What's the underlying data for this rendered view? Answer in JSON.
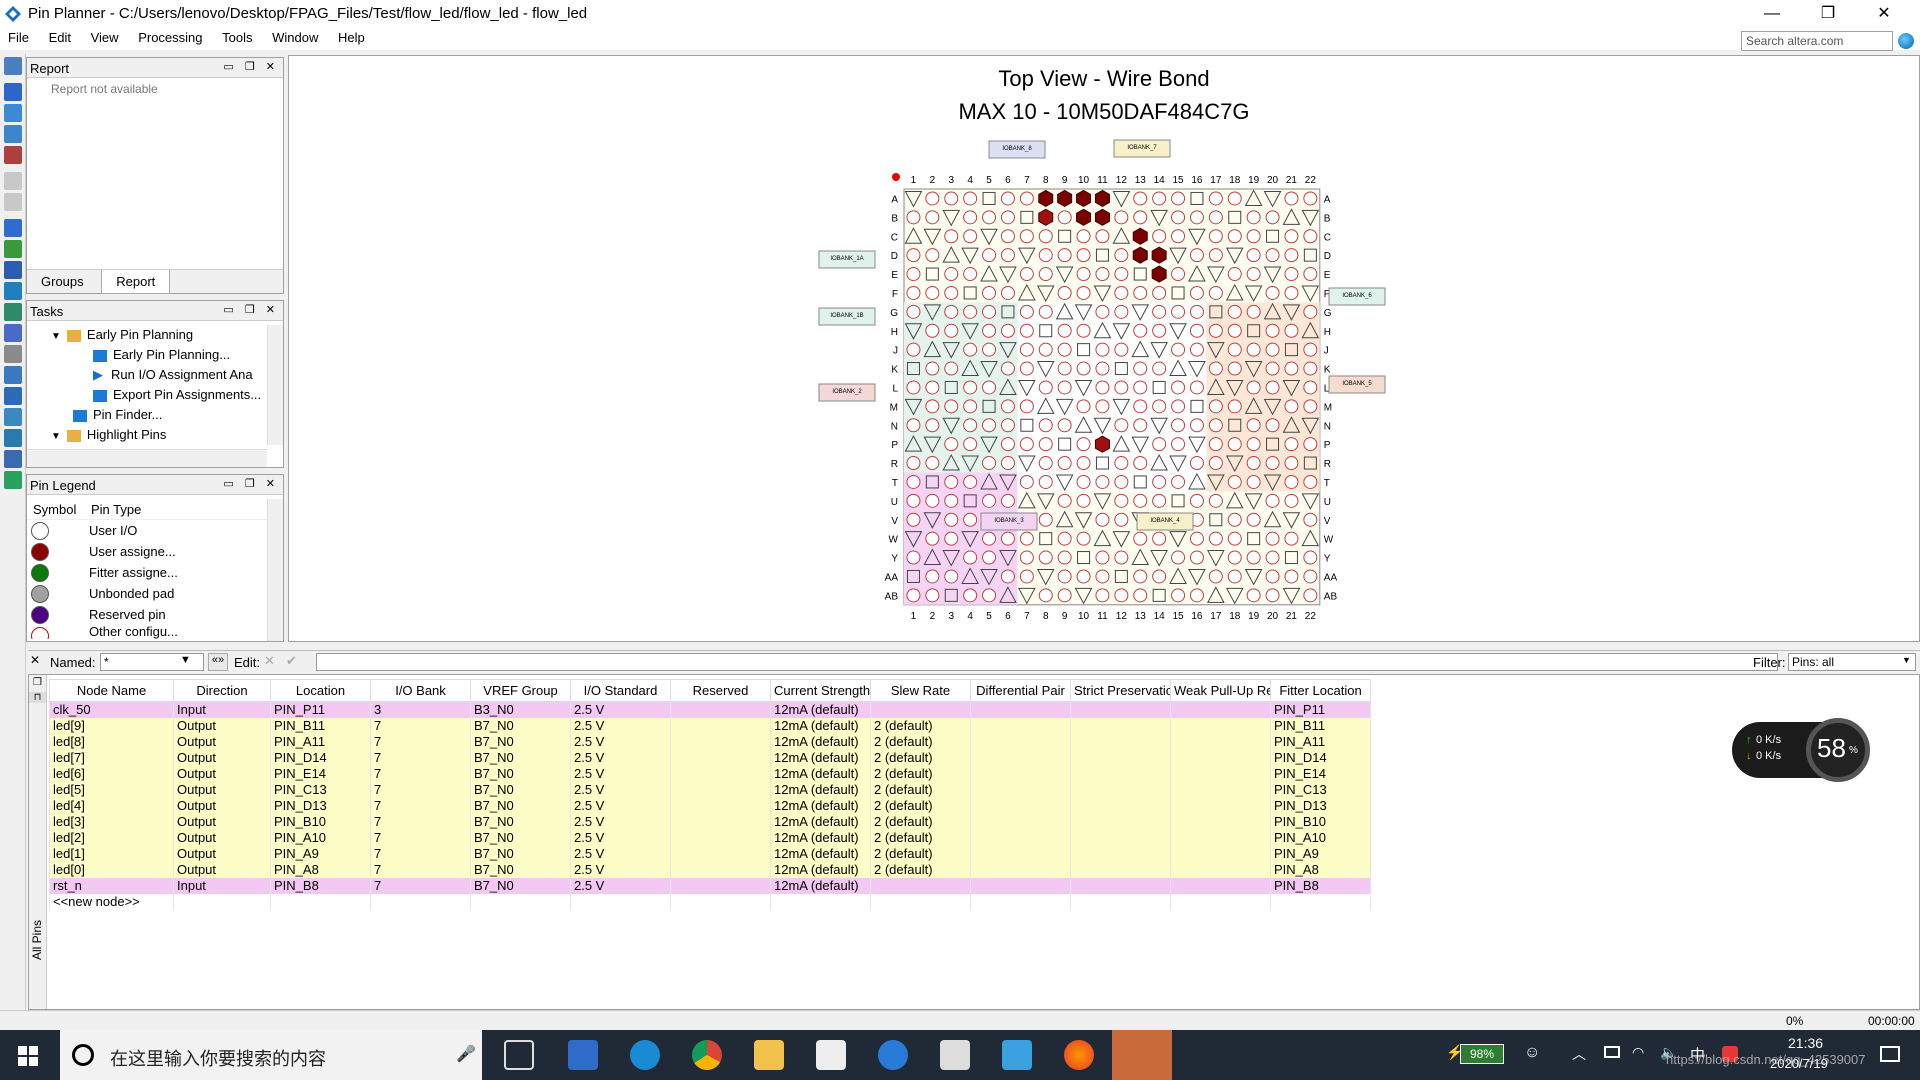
{
  "window": {
    "title": "Pin Planner - C:/Users/lenovo/Desktop/FPAG_Files/Test/flow_led/flow_led - flow_led",
    "minimize": "—",
    "restore": "❐",
    "close": "✕"
  },
  "menu": [
    "File",
    "Edit",
    "View",
    "Processing",
    "Tools",
    "Window",
    "Help"
  ],
  "search": {
    "placeholder": "Search altera.com"
  },
  "report_panel": {
    "title": "Report",
    "text": "Report not available",
    "tabs": [
      "Groups",
      "Report"
    ]
  },
  "tasks_panel": {
    "title": "Tasks",
    "items": [
      "Early Pin Planning",
      "Early Pin Planning...",
      "Run I/O Assignment Ana",
      "Export Pin Assignments...",
      "Pin Finder...",
      "Highlight Pins"
    ]
  },
  "legend_panel": {
    "title": "Pin Legend",
    "col_symbol": "Symbol",
    "col_type": "Pin Type",
    "items": [
      {
        "label": "User I/O",
        "color": "#ffffff"
      },
      {
        "label": "User assigne...",
        "color": "#8b0000"
      },
      {
        "label": "Fitter assigne...",
        "color": "#0a7a0a"
      },
      {
        "label": "Unbonded pad",
        "color": "#a0a0a0"
      },
      {
        "label": "Reserved pin",
        "color": "#4b0082"
      },
      {
        "label": "Other configu...",
        "color": "#ffffff"
      }
    ]
  },
  "chip": {
    "title": "Top View - Wire Bond",
    "device": "MAX 10 - 10M50DAF484C7G",
    "cols": [
      "1",
      "2",
      "3",
      "4",
      "5",
      "6",
      "7",
      "8",
      "9",
      "10",
      "11",
      "12",
      "13",
      "14",
      "15",
      "16",
      "17",
      "18",
      "19",
      "20",
      "21",
      "22"
    ],
    "rows": [
      "A",
      "B",
      "C",
      "D",
      "E",
      "F",
      "G",
      "H",
      "J",
      "K",
      "L",
      "M",
      "N",
      "P",
      "R",
      "T",
      "U",
      "V",
      "W",
      "Y",
      "AA",
      "AB"
    ],
    "banks": [
      {
        "label": "IOBANK_8"
      },
      {
        "label": "IOBANK_7"
      },
      {
        "label": "IOBANK_1A"
      },
      {
        "label": "IOBANK_1B"
      },
      {
        "label": "IOBANK_2"
      },
      {
        "label": "IOBANK_6"
      },
      {
        "label": "IOBANK_5"
      },
      {
        "label": "IOBANK_3"
      },
      {
        "label": "IOBANK_4"
      }
    ]
  },
  "filterbar": {
    "named_label": "Named:",
    "named_value": "*",
    "edit_label": "Edit:",
    "filter_label": "Filter:",
    "filter_value": "Pins: all"
  },
  "table": {
    "headers": [
      "Node Name",
      "Direction",
      "Location",
      "I/O Bank",
      "VREF Group",
      "I/O Standard",
      "Reserved",
      "Current Strength",
      "Slew Rate",
      "Differential Pair",
      "Strict Preservation",
      "Weak Pull-Up Resistor",
      "Fitter Location"
    ],
    "rows": [
      {
        "dir": "in",
        "cells": [
          "clk_50",
          "Input",
          "PIN_P11",
          "3",
          "B3_N0",
          "2.5 V",
          "",
          "12mA (default)",
          "",
          "",
          "",
          "",
          "PIN_P11"
        ]
      },
      {
        "dir": "out",
        "cells": [
          "led[9]",
          "Output",
          "PIN_B11",
          "7",
          "B7_N0",
          "2.5 V",
          "",
          "12mA (default)",
          "2 (default)",
          "",
          "",
          "",
          "PIN_B11"
        ]
      },
      {
        "dir": "out",
        "cells": [
          "led[8]",
          "Output",
          "PIN_A11",
          "7",
          "B7_N0",
          "2.5 V",
          "",
          "12mA (default)",
          "2 (default)",
          "",
          "",
          "",
          "PIN_A11"
        ]
      },
      {
        "dir": "out",
        "cells": [
          "led[7]",
          "Output",
          "PIN_D14",
          "7",
          "B7_N0",
          "2.5 V",
          "",
          "12mA (default)",
          "2 (default)",
          "",
          "",
          "",
          "PIN_D14"
        ]
      },
      {
        "dir": "out",
        "cells": [
          "led[6]",
          "Output",
          "PIN_E14",
          "7",
          "B7_N0",
          "2.5 V",
          "",
          "12mA (default)",
          "2 (default)",
          "",
          "",
          "",
          "PIN_E14"
        ]
      },
      {
        "dir": "out",
        "cells": [
          "led[5]",
          "Output",
          "PIN_C13",
          "7",
          "B7_N0",
          "2.5 V",
          "",
          "12mA (default)",
          "2 (default)",
          "",
          "",
          "",
          "PIN_C13"
        ]
      },
      {
        "dir": "out",
        "cells": [
          "led[4]",
          "Output",
          "PIN_D13",
          "7",
          "B7_N0",
          "2.5 V",
          "",
          "12mA (default)",
          "2 (default)",
          "",
          "",
          "",
          "PIN_D13"
        ]
      },
      {
        "dir": "out",
        "cells": [
          "led[3]",
          "Output",
          "PIN_B10",
          "7",
          "B7_N0",
          "2.5 V",
          "",
          "12mA (default)",
          "2 (default)",
          "",
          "",
          "",
          "PIN_B10"
        ]
      },
      {
        "dir": "out",
        "cells": [
          "led[2]",
          "Output",
          "PIN_A10",
          "7",
          "B7_N0",
          "2.5 V",
          "",
          "12mA (default)",
          "2 (default)",
          "",
          "",
          "",
          "PIN_A10"
        ]
      },
      {
        "dir": "out",
        "cells": [
          "led[1]",
          "Output",
          "PIN_A9",
          "7",
          "B7_N0",
          "2.5 V",
          "",
          "12mA (default)",
          "2 (default)",
          "",
          "",
          "",
          "PIN_A9"
        ]
      },
      {
        "dir": "out",
        "cells": [
          "led[0]",
          "Output",
          "PIN_A8",
          "7",
          "B7_N0",
          "2.5 V",
          "",
          "12mA (default)",
          "2 (default)",
          "",
          "",
          "",
          "PIN_A8"
        ]
      },
      {
        "dir": "in",
        "cells": [
          "rst_n",
          "Input",
          "PIN_B8",
          "7",
          "B7_N0",
          "2.5 V",
          "",
          "12mA (default)",
          "",
          "",
          "",
          "",
          "PIN_B8"
        ]
      }
    ],
    "new_node": "<<new node>>",
    "side_label": "All Pins"
  },
  "status": {
    "percent": "0%",
    "time": "00:00:00"
  },
  "netwidget": {
    "up": "0 K/s",
    "down": "0 K/s",
    "percent": "58",
    "percent_sign": "%"
  },
  "taskbar": {
    "search_placeholder": "在这里输入你要搜索的内容",
    "battery": "98%",
    "time": "21:36",
    "date": "2020/7/19",
    "ime": "中",
    "watermark": "https://blog.csdn.net/qq_42539007"
  }
}
